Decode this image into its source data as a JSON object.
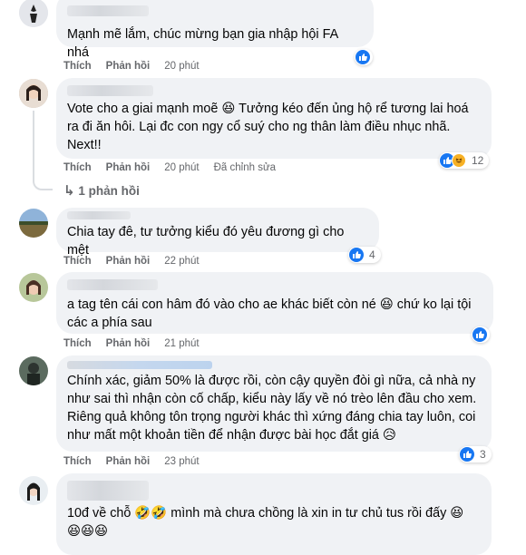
{
  "comments": [
    {
      "text": "Mạnh mẽ lắm, chúc mừng bạn gia nhập hội FA nhá",
      "actions": {
        "like": "Thích",
        "reply": "Phản hồi",
        "time": "20 phút"
      },
      "reactions": {
        "types": [
          "like"
        ],
        "count": ""
      }
    },
    {
      "text": "Vote cho a giai mạnh moẽ 😆 Tưởng kéo đến ủng hộ rể tương lai hoá ra đi ăn hôi. Lại đc con ngy cổ suý cho ng thân làm điều nhục nhã. Next!!",
      "actions": {
        "like": "Thích",
        "reply": "Phản hồi",
        "time": "20 phút",
        "edited": "Đã chỉnh sửa"
      },
      "reactions": {
        "types": [
          "like",
          "haha"
        ],
        "count": "12"
      },
      "replies_link": "1 phản hồi"
    },
    {
      "text": "Chia tay đê, tư tưởng kiểu đó yêu đương gì cho mệt",
      "actions": {
        "like": "Thích",
        "reply": "Phản hồi",
        "time": "22 phút"
      },
      "reactions": {
        "types": [
          "like"
        ],
        "count": "4"
      }
    },
    {
      "text": "a tag tên cái con hâm đó vào cho ae khác biết còn né 😆 chứ ko lại tội các a phía sau",
      "actions": {
        "like": "Thích",
        "reply": "Phản hồi",
        "time": "21 phút"
      },
      "reactions": {
        "types": [
          "like"
        ],
        "count": ""
      }
    },
    {
      "text": "Chính xác, giảm 50% là được rồi, còn cậy quyền đòi gì nữa, cả nhà ny như sai thì nhận còn cố chấp, kiểu này lấy về nó trèo lên đầu cho xem. Riêng quả không tôn trọng người khác thì xứng đáng chia tay luôn, coi như mất một khoản tiền để nhận được bài học đắt giá 😥",
      "actions": {
        "like": "Thích",
        "reply": "Phản hồi",
        "time": "23 phút"
      },
      "reactions": {
        "types": [
          "like"
        ],
        "count": "3"
      }
    },
    {
      "text": "10đ về chỗ 🤣🤣 mình mà chưa chồng là xin in tư chủ tus rồi đấy 😆 😆😆😆",
      "actions": {},
      "reactions": {
        "types": [],
        "count": ""
      }
    }
  ]
}
